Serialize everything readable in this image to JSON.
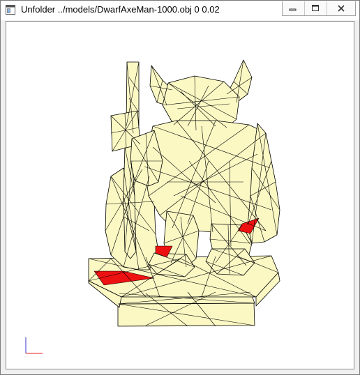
{
  "window": {
    "title": "Unfolder ../models/DwarfAxeMan-1000.obj 0 0.02"
  },
  "icons": {
    "app": "app-window-icon",
    "minimize": "minimize-icon",
    "maximize": "maximize-icon",
    "close": "close-icon"
  },
  "colors": {
    "model_fill": "#fbf8c4",
    "highlight_faces": "#ee1111",
    "edges": "#000000",
    "axis_x": "#ee2222",
    "axis_y": "#3333cc"
  }
}
